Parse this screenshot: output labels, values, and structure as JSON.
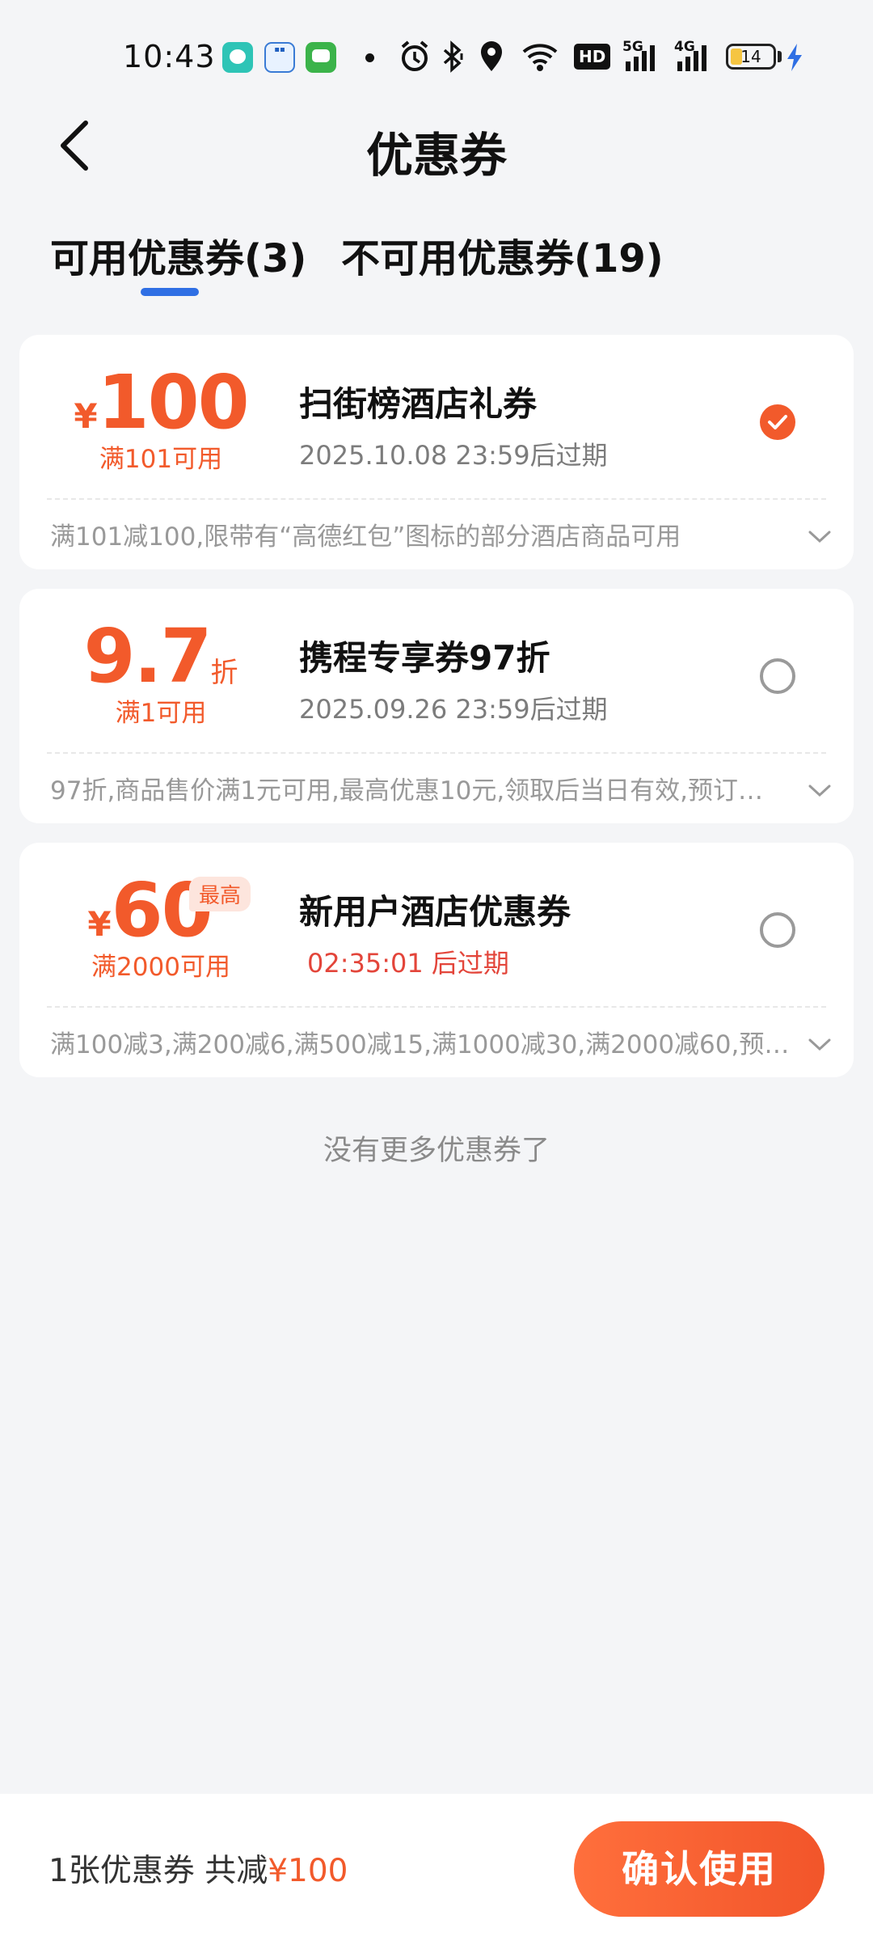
{
  "status_bar": {
    "time": "10:43",
    "notifications": [
      "chat-app-icon",
      "live-app-icon",
      "messages-app-icon"
    ],
    "system_icons": [
      "alarm-icon",
      "bluetooth-icon",
      "location-icon",
      "wifi-icon",
      "hd-icon",
      "signal-5g-icon",
      "signal-4g-icon"
    ],
    "hd_label": "HD",
    "net_5g": "5G",
    "net_4g": "4G",
    "battery_level": "14"
  },
  "header": {
    "title": "优惠券",
    "back_icon": "back-arrow-icon"
  },
  "tabs": [
    {
      "label": "可用优惠券(3)",
      "active": true
    },
    {
      "label": "不可用优惠券(19)",
      "active": false
    }
  ],
  "coupons": [
    {
      "currency": "¥",
      "amount": "100",
      "condition": "满101可用",
      "name": "扫街榜酒店礼券",
      "expiry": "2025.10.08 23:59后过期",
      "description": "满101减100,限带有“高德红包”图标的部分酒店商品可用",
      "selected": true
    },
    {
      "amount": "9.7",
      "unit": "折",
      "condition": "满1可用",
      "name": "携程专享券97折",
      "expiry": "2025.09.26 23:59后过期",
      "description": "97折,商品售价满1元可用,最高优惠10元,领取后当日有效,预订…",
      "selected": false
    },
    {
      "currency": "¥",
      "amount": "60",
      "badge": "最高",
      "condition": "满2000可用",
      "name": "新用户酒店优惠券",
      "expiry": "02:35:01 后过期",
      "description": "满100减3,满200减6,满500减15,满1000减30,满2000减60,预…",
      "selected": false
    }
  ],
  "no_more_text": "没有更多优惠券了",
  "bottom_bar": {
    "summary_prefix": "1张优惠券 共减",
    "summary_amount": "¥100",
    "confirm_label": "确认使用"
  },
  "colors": {
    "accent": "#f25a2b",
    "tab_indicator": "#2f6fe4",
    "countdown": "#e3453a",
    "background": "#f4f5f7"
  }
}
